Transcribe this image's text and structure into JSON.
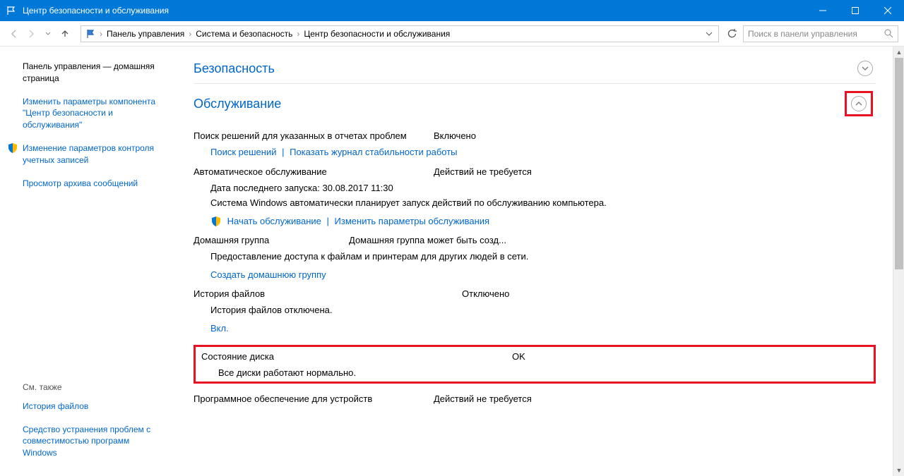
{
  "window": {
    "title": "Центр безопасности и обслуживания"
  },
  "breadcrumb": {
    "items": [
      "Панель управления",
      "Система и безопасность",
      "Центр безопасности и обслуживания"
    ]
  },
  "search": {
    "placeholder": "Поиск в панели управления"
  },
  "sidebar": {
    "home": "Панель управления — домашняя страница",
    "links": [
      "Изменить параметры компонента \"Центр безопасности и обслуживания\"",
      "Изменение параметров контроля учетных записей",
      "Просмотр архива сообщений"
    ],
    "seealso_title": "См. также",
    "seealso": [
      "История файлов",
      "Средство устранения проблем с совместимостью программ Windows"
    ]
  },
  "sections": {
    "security": "Безопасность",
    "maintenance": "Обслуживание"
  },
  "maint": {
    "reports": {
      "label": "Поиск решений для указанных в отчетах проблем",
      "status": "Включено",
      "link1": "Поиск решений",
      "link2": "Показать журнал стабильности работы"
    },
    "auto": {
      "label": "Автоматическое обслуживание",
      "status": "Действий не требуется",
      "lastrun": "Дата последнего запуска: 30.08.2017 11:30",
      "desc": "Система Windows автоматически планирует запуск действий по обслуживанию компьютера.",
      "link1": "Начать обслуживание",
      "link2": "Изменить параметры обслуживания"
    },
    "homegroup": {
      "label": "Домашняя группа",
      "status": "Домашняя группа может быть созд...",
      "desc": "Предоставление доступа к файлам и принтерам для других людей в сети.",
      "link": "Создать домашнюю группу"
    },
    "filehistory": {
      "label": "История файлов",
      "status": "Отключено",
      "desc": "История файлов отключена.",
      "link": "Вкл."
    },
    "disk": {
      "label": "Состояние диска",
      "status": "OK",
      "desc": "Все диски работают нормально."
    },
    "devicesoft": {
      "label": "Программное обеспечение для устройств",
      "status": "Действий не требуется"
    }
  }
}
